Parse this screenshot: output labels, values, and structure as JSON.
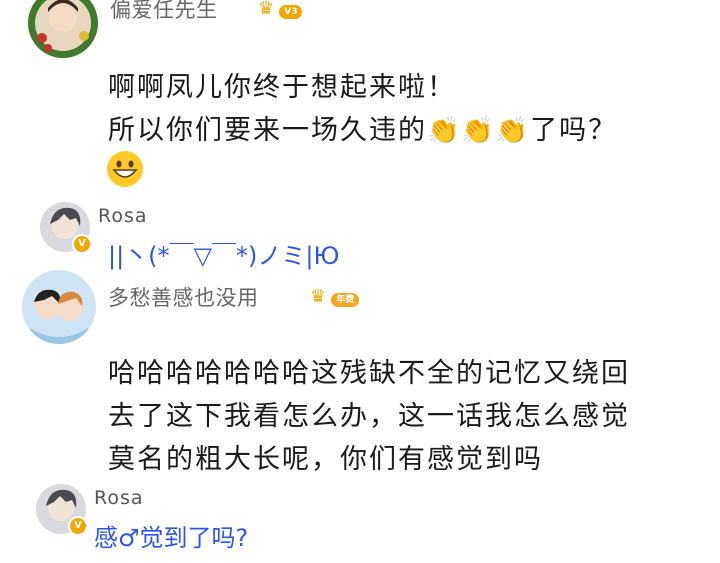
{
  "comments": [
    {
      "username": "偏爱任先生",
      "vip_level": "V3",
      "text_lines": [
        "啊啊凤儿你终于想起来啦！",
        "所以你们要来一场久违的",
        "了吗？"
      ],
      "emoji_claps": [
        "clap-icon",
        "clap-icon",
        "clap-icon"
      ],
      "emoji_smile": "grin-icon"
    },
    {
      "username": "Rosa",
      "verified": "V",
      "text": "||丶(*￣▽￣*)ノミ|Ю"
    },
    {
      "username": "多愁善感也没用",
      "vip_badge": "年费",
      "text_lines": [
        "哈哈哈哈哈哈哈这残缺不全的记忆又绕回",
        "去了这下我看怎么办，这一话我怎么感觉",
        "莫名的粗大长呢，你们有感觉到吗"
      ]
    },
    {
      "username": "Rosa",
      "verified": "V",
      "text": "感♂觉到了吗?"
    }
  ],
  "colors": {
    "reply_blue": "#2c55e8",
    "vip_gold": "#f0a800",
    "username_gray": "#666666"
  }
}
